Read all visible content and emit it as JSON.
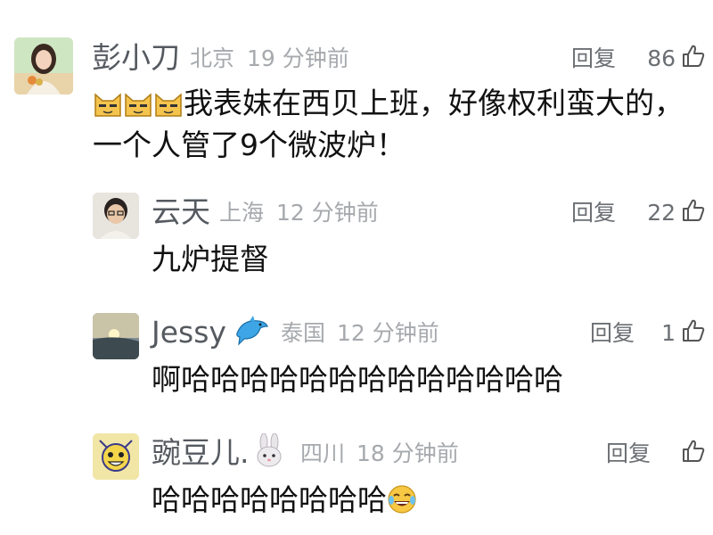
{
  "comments": [
    {
      "name": "彭小刀",
      "location": "北京",
      "time": "19 分钟前",
      "reply": "回复",
      "likes": "86",
      "text_line1": "我表妹在西贝上班，好像权利蛮大的，",
      "text_line2": "一个人管了9个微波炉！",
      "prefix_emojis": [
        "cat-face-emoji",
        "cat-face-emoji",
        "cat-face-emoji"
      ]
    },
    {
      "name": "云天",
      "location": "上海",
      "time": "12 分钟前",
      "reply": "回复",
      "likes": "22",
      "text": "九炉提督"
    },
    {
      "name": "Jessy",
      "badge_icon": "dolphin-emoji",
      "location": "泰国",
      "time": "12 分钟前",
      "reply": "回复",
      "likes": "1",
      "text": "啊哈哈哈哈哈哈哈哈哈哈哈哈哈"
    },
    {
      "name": "豌豆儿.",
      "badge_icon": "rabbit-emoji",
      "location": "四川",
      "time": "18 分钟前",
      "reply": "回复",
      "likes": "",
      "text": "哈哈哈哈哈哈哈哈",
      "suffix_emoji": "tears-of-joy-emoji"
    }
  ],
  "colors": {
    "name": "#555a60",
    "meta": "#a6a9ad",
    "body_text": "#111111",
    "action": "#6b6f73"
  }
}
